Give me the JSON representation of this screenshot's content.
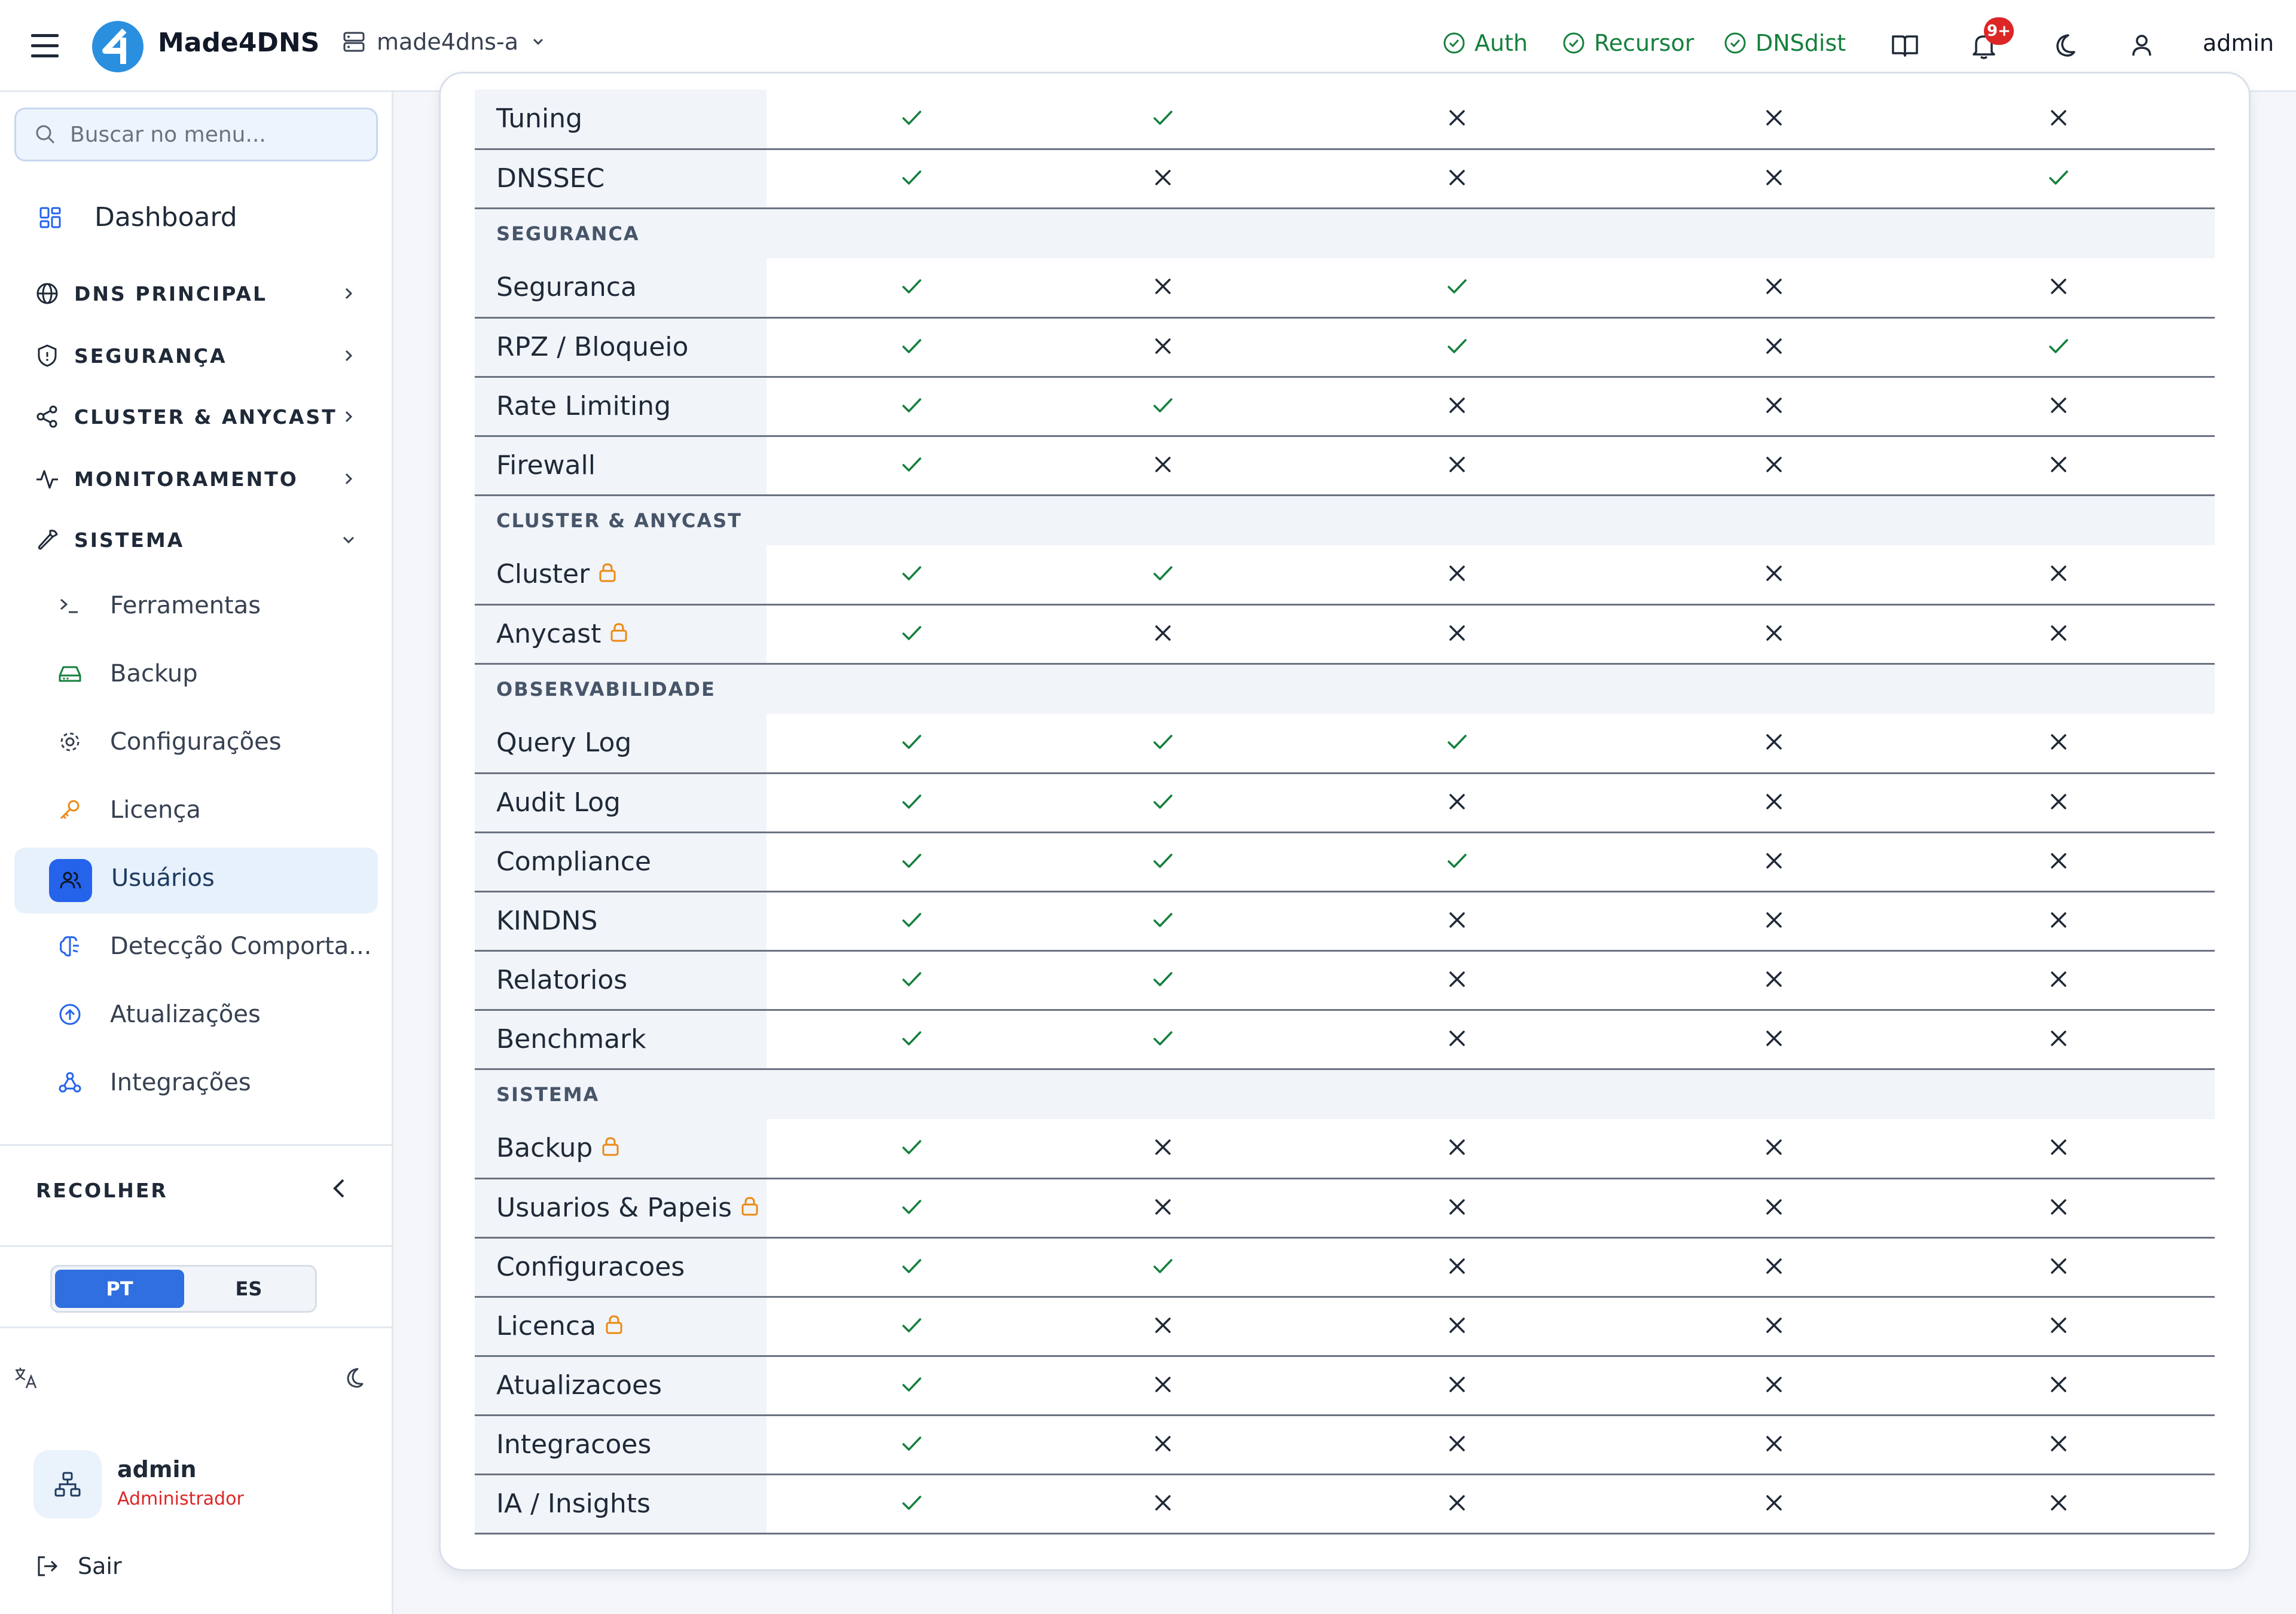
{
  "header": {
    "brand": "Made4DNS",
    "server": "made4dns-a",
    "status": [
      {
        "label": "Auth",
        "name": "status-auth"
      },
      {
        "label": "Recursor",
        "name": "status-recursor"
      },
      {
        "label": "DNSdist",
        "name": "status-dnsdist"
      }
    ],
    "notif_badge": "9+",
    "user": "admin",
    "status_color": "#15803d",
    "badge_color": "#dc2626"
  },
  "sidebar": {
    "search_placeholder": "Buscar no menu...",
    "dashboard": "Dashboard",
    "sections": [
      {
        "label": "DNS PRINCIPAL",
        "icon": "globe-icon",
        "expanded": false
      },
      {
        "label": "SEGURANÇA",
        "icon": "shield-icon",
        "expanded": false
      },
      {
        "label": "CLUSTER & ANYCAST",
        "icon": "share-icon",
        "expanded": false
      },
      {
        "label": "MONITORAMENTO",
        "icon": "activity-icon",
        "expanded": false
      },
      {
        "label": "SISTEMA",
        "icon": "wrench-icon",
        "expanded": true
      }
    ],
    "items": [
      {
        "label": "Ferramentas",
        "icon": "terminal-icon"
      },
      {
        "label": "Backup",
        "icon": "hard-drive-icon"
      },
      {
        "label": "Configurações",
        "icon": "gear-icon"
      },
      {
        "label": "Licença",
        "icon": "key-icon"
      },
      {
        "label": "Usuários",
        "icon": "users-icon",
        "active": true
      },
      {
        "label": "Detecção Comporta...",
        "icon": "brain-icon"
      },
      {
        "label": "Atualizações",
        "icon": "arrow-up-circle-icon"
      },
      {
        "label": "Integrações",
        "icon": "webhook-icon"
      }
    ],
    "collapse_label": "RECOLHER",
    "lang_pt": "PT",
    "lang_es": "ES",
    "lang_selected": "PT",
    "user_name": "admin",
    "user_role": "Administrador",
    "logout": "Sair",
    "accent_color": "#2563eb"
  },
  "permissions": {
    "check_color": "#15803d",
    "cross_color": "#1f2937",
    "lock_color": "#ea8a12",
    "rows": [
      {
        "type": "row",
        "label": "Tuning",
        "lock": false,
        "values": [
          true,
          true,
          false,
          false,
          false
        ]
      },
      {
        "type": "row",
        "label": "DNSSEC",
        "lock": false,
        "values": [
          true,
          false,
          false,
          false,
          true
        ]
      },
      {
        "type": "section",
        "label": "SEGURANCA"
      },
      {
        "type": "row",
        "label": "Seguranca",
        "lock": false,
        "values": [
          true,
          false,
          true,
          false,
          false
        ]
      },
      {
        "type": "row",
        "label": "RPZ / Bloqueio",
        "lock": false,
        "values": [
          true,
          false,
          true,
          false,
          true
        ]
      },
      {
        "type": "row",
        "label": "Rate Limiting",
        "lock": false,
        "values": [
          true,
          true,
          false,
          false,
          false
        ]
      },
      {
        "type": "row",
        "label": "Firewall",
        "lock": false,
        "values": [
          true,
          false,
          false,
          false,
          false
        ]
      },
      {
        "type": "section",
        "label": "CLUSTER & ANYCAST"
      },
      {
        "type": "row",
        "label": "Cluster",
        "lock": true,
        "values": [
          true,
          true,
          false,
          false,
          false
        ]
      },
      {
        "type": "row",
        "label": "Anycast",
        "lock": true,
        "values": [
          true,
          false,
          false,
          false,
          false
        ]
      },
      {
        "type": "section",
        "label": "OBSERVABILIDADE"
      },
      {
        "type": "row",
        "label": "Query Log",
        "lock": false,
        "values": [
          true,
          true,
          true,
          false,
          false
        ]
      },
      {
        "type": "row",
        "label": "Audit Log",
        "lock": false,
        "values": [
          true,
          true,
          false,
          false,
          false
        ]
      },
      {
        "type": "row",
        "label": "Compliance",
        "lock": false,
        "values": [
          true,
          true,
          true,
          false,
          false
        ]
      },
      {
        "type": "row",
        "label": "KINDNS",
        "lock": false,
        "values": [
          true,
          true,
          false,
          false,
          false
        ]
      },
      {
        "type": "row",
        "label": "Relatorios",
        "lock": false,
        "values": [
          true,
          true,
          false,
          false,
          false
        ]
      },
      {
        "type": "row",
        "label": "Benchmark",
        "lock": false,
        "values": [
          true,
          true,
          false,
          false,
          false
        ]
      },
      {
        "type": "section",
        "label": "SISTEMA"
      },
      {
        "type": "row",
        "label": "Backup",
        "lock": true,
        "values": [
          true,
          false,
          false,
          false,
          false
        ]
      },
      {
        "type": "row",
        "label": "Usuarios & Papeis",
        "lock": true,
        "values": [
          true,
          false,
          false,
          false,
          false
        ]
      },
      {
        "type": "row",
        "label": "Configuracoes",
        "lock": false,
        "values": [
          true,
          true,
          false,
          false,
          false
        ]
      },
      {
        "type": "row",
        "label": "Licenca",
        "lock": true,
        "values": [
          true,
          false,
          false,
          false,
          false
        ]
      },
      {
        "type": "row",
        "label": "Atualizacoes",
        "lock": false,
        "values": [
          true,
          false,
          false,
          false,
          false
        ]
      },
      {
        "type": "row",
        "label": "Integracoes",
        "lock": false,
        "values": [
          true,
          false,
          false,
          false,
          false
        ]
      },
      {
        "type": "row",
        "label": "IA / Insights",
        "lock": false,
        "values": [
          true,
          false,
          false,
          false,
          false
        ]
      }
    ]
  }
}
